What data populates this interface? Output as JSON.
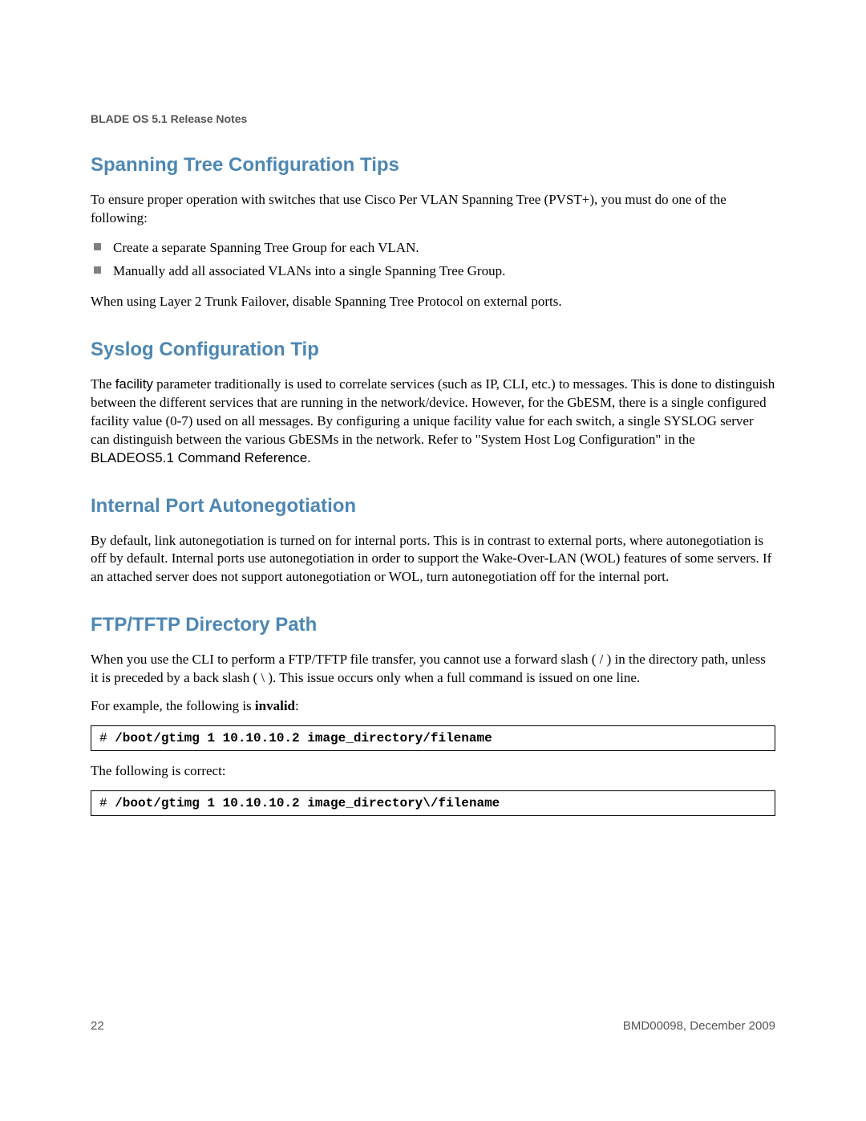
{
  "header": "BLADE OS 5.1 Release Notes",
  "sections": {
    "spanning": {
      "title": "Spanning Tree Configuration Tips",
      "intro": "To ensure proper operation with switches that use Cisco Per VLAN Spanning Tree (PVST+), you must do one of the following:",
      "bullets": [
        "Create a separate Spanning Tree Group for each VLAN.",
        "Manually add all associated VLANs into a single Spanning Tree Group."
      ],
      "outro": "When using Layer 2 Trunk Failover, disable Spanning Tree Protocol on external ports."
    },
    "syslog": {
      "title": "Syslog Configuration Tip",
      "p1a": "The ",
      "p1_facility": "facility",
      "p1b": " parameter traditionally is used to correlate services (such as IP, CLI, etc.) to messages. This is done to distinguish between the different services that are running in the network/device. However, for the GbESM, there is a single configured facility value (0-7) used on all messages. By configuring a unique facility value for each switch, a single SYSLOG server can distinguish between the various GbESMs in the network. Refer to \"System Host Log Configuration\" in the ",
      "p1_ref": "BLADEOS5.1 Command Reference",
      "p1c": "."
    },
    "autoneg": {
      "title": "Internal Port Autonegotiation",
      "p1": "By default, link autonegotiation is turned on for internal ports. This is in contrast to external ports, where autonegotiation is off by default. Internal ports use autonegotiation in order to support the Wake-Over-LAN (WOL) features of some servers. If an attached server does not support autonegotiation or WOL, turn autonegotiation off for the internal port."
    },
    "ftp": {
      "title": "FTP/TFTP Directory Path",
      "p1": "When you use the CLI to perform a FTP/TFTP file transfer, you cannot use a forward slash (  /  ) in the directory path, unless it is preceded by a back slash (  \\  ). This issue occurs only when a full command is issued on one line.",
      "p2a": "For example, the following is ",
      "p2b": "invalid",
      "p2c": ":",
      "code1_prompt": "# ",
      "code1_cmd": "/boot/gtimg 1 10.10.10.2 image_directory/filename",
      "p3": "The following is correct:",
      "code2_prompt": "# ",
      "code2_cmd": "/boot/gtimg 1 10.10.10.2 image_directory\\/filename"
    }
  },
  "footer": {
    "page": "22",
    "doc": "BMD00098, December 2009"
  }
}
